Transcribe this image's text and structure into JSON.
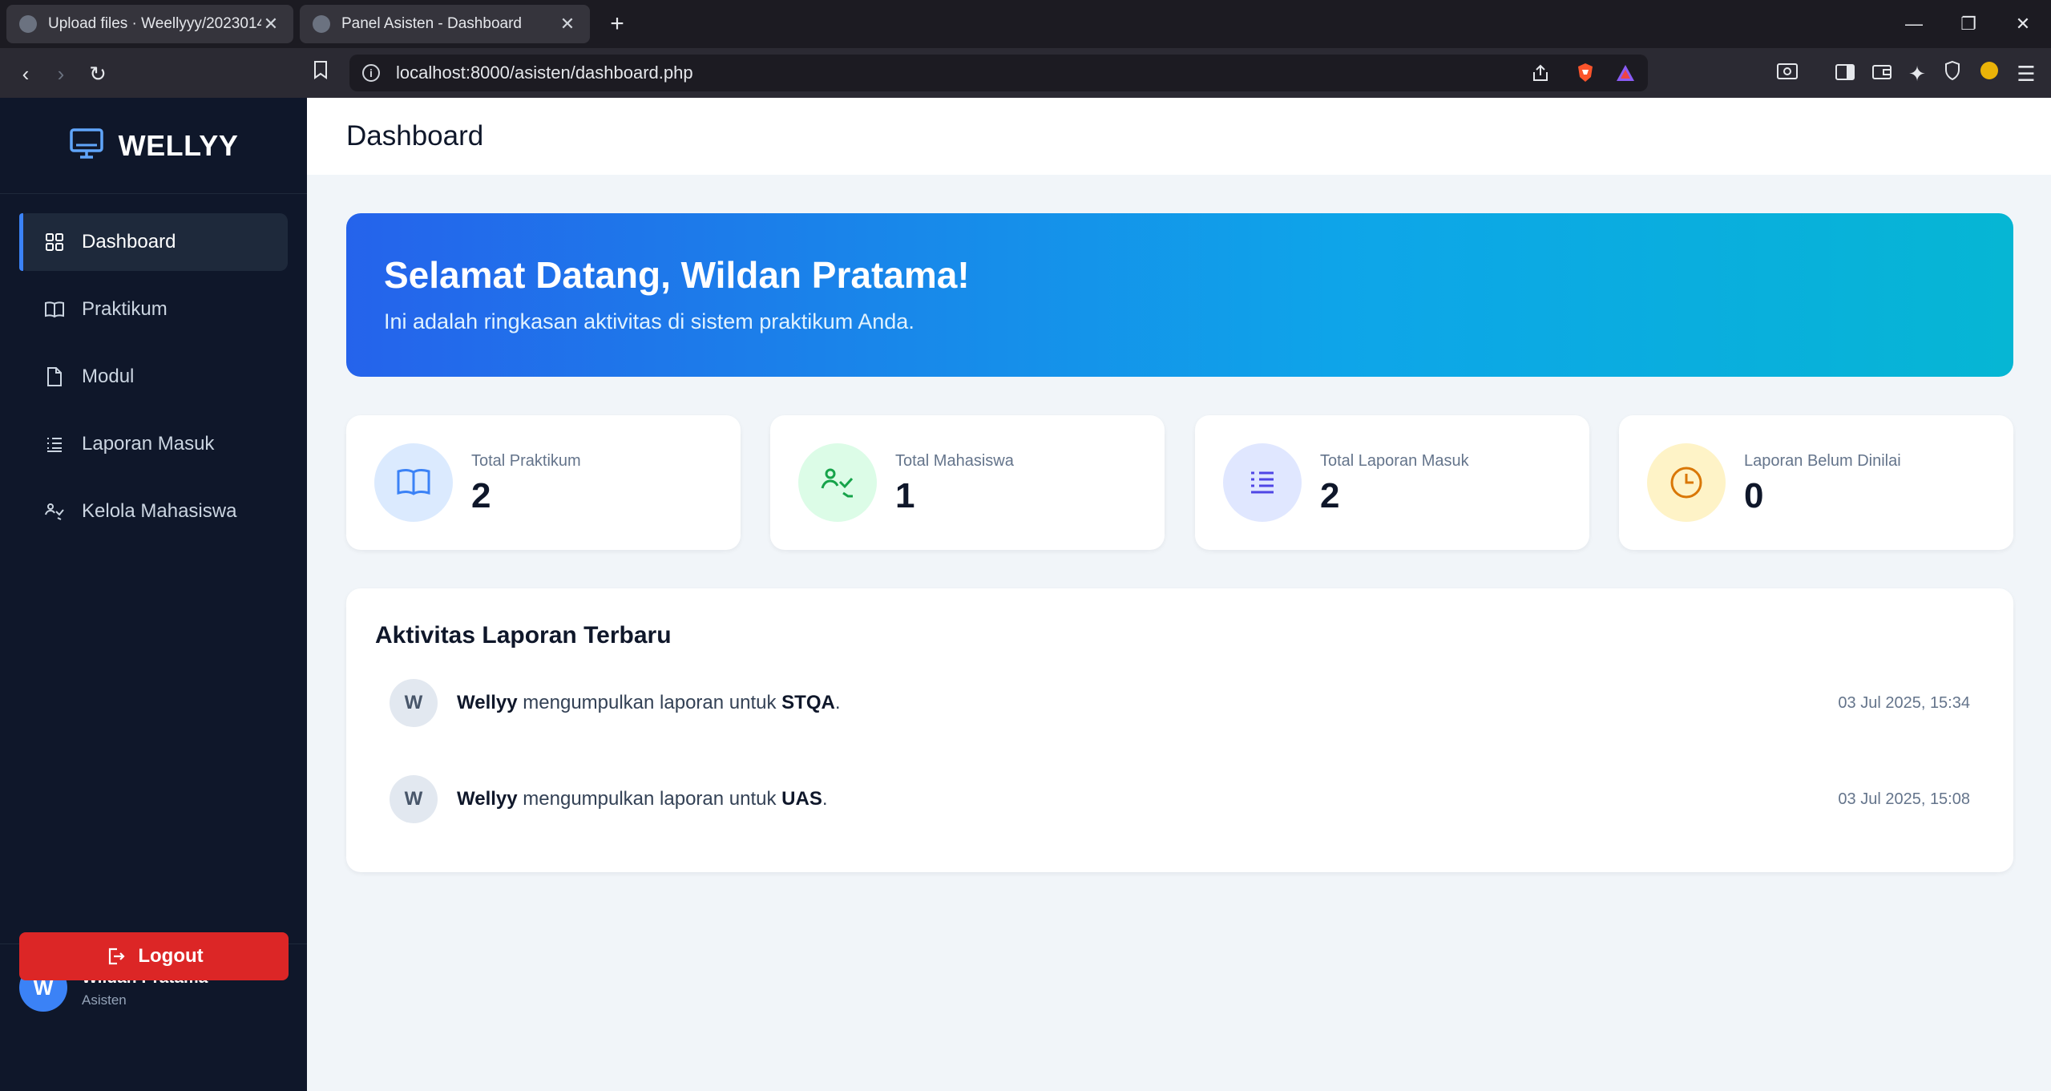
{
  "browser": {
    "tabs": [
      {
        "title": "Upload files · Weellyyy/2023014"
      },
      {
        "title": "Panel Asisten - Dashboard"
      }
    ],
    "url": "localhost:8000/asisten/dashboard.php"
  },
  "sidebar": {
    "brand": "WELLYY",
    "items": [
      {
        "label": "Dashboard",
        "icon": "grid-icon"
      },
      {
        "label": "Praktikum",
        "icon": "book-icon"
      },
      {
        "label": "Modul",
        "icon": "file-icon"
      },
      {
        "label": "Laporan Masuk",
        "icon": "list-icon"
      },
      {
        "label": "Kelola Mahasiswa",
        "icon": "users-icon"
      }
    ],
    "user": {
      "initial": "W",
      "name": "Wildan Pratama",
      "role": "Asisten"
    },
    "logout_label": "Logout"
  },
  "header": {
    "title": "Dashboard"
  },
  "hero": {
    "title": "Selamat Datang, Wildan Pratama!",
    "subtitle": "Ini adalah ringkasan aktivitas di sistem praktikum Anda."
  },
  "stats": [
    {
      "label": "Total Praktikum",
      "value": "2",
      "color": "#3b82f6"
    },
    {
      "label": "Total Mahasiswa",
      "value": "1",
      "color": "#16a34a"
    },
    {
      "label": "Total Laporan Masuk",
      "value": "2",
      "color": "#4f46e5"
    },
    {
      "label": "Laporan Belum Dinilai",
      "value": "0",
      "color": "#d97706"
    }
  ],
  "activity": {
    "title": "Aktivitas Laporan Terbaru",
    "items": [
      {
        "initial": "W",
        "user": "Wellyy",
        "text": " mengumpulkan laporan untuk ",
        "subject": "STQA",
        "end": ".",
        "time": "03 Jul 2025, 15:34"
      },
      {
        "initial": "W",
        "user": "Wellyy",
        "text": " mengumpulkan laporan untuk ",
        "subject": "UAS",
        "end": ".",
        "time": "03 Jul 2025, 15:08"
      }
    ]
  }
}
